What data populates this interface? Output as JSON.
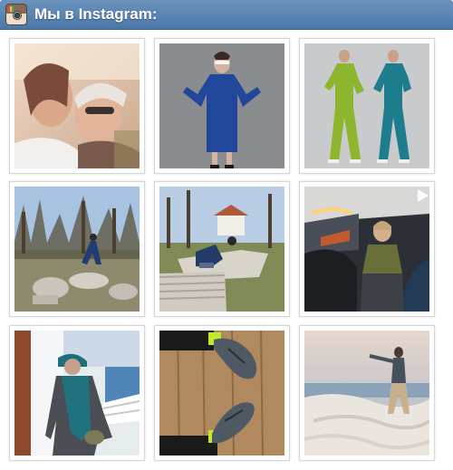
{
  "header": {
    "title": "Мы в Instagram:",
    "icon": "instagram-logo-icon",
    "colors": {
      "bar": "#4a76a8",
      "text": "#ffffff"
    }
  },
  "photos": [
    {
      "index": 1,
      "subject": "selfie-two-women"
    },
    {
      "index": 2,
      "subject": "woman-blue-dress"
    },
    {
      "index": 3,
      "subject": "two-models-suits"
    },
    {
      "index": 4,
      "subject": "ruins-columns-1"
    },
    {
      "index": 5,
      "subject": "ruins-columns-2"
    },
    {
      "index": 6,
      "subject": "video-bus-interior",
      "video": true
    },
    {
      "index": 7,
      "subject": "woman-teal-scarf-ship"
    },
    {
      "index": 8,
      "subject": "shoes-wooden-floor"
    },
    {
      "index": 9,
      "subject": "pamukkale-travertine"
    }
  ]
}
